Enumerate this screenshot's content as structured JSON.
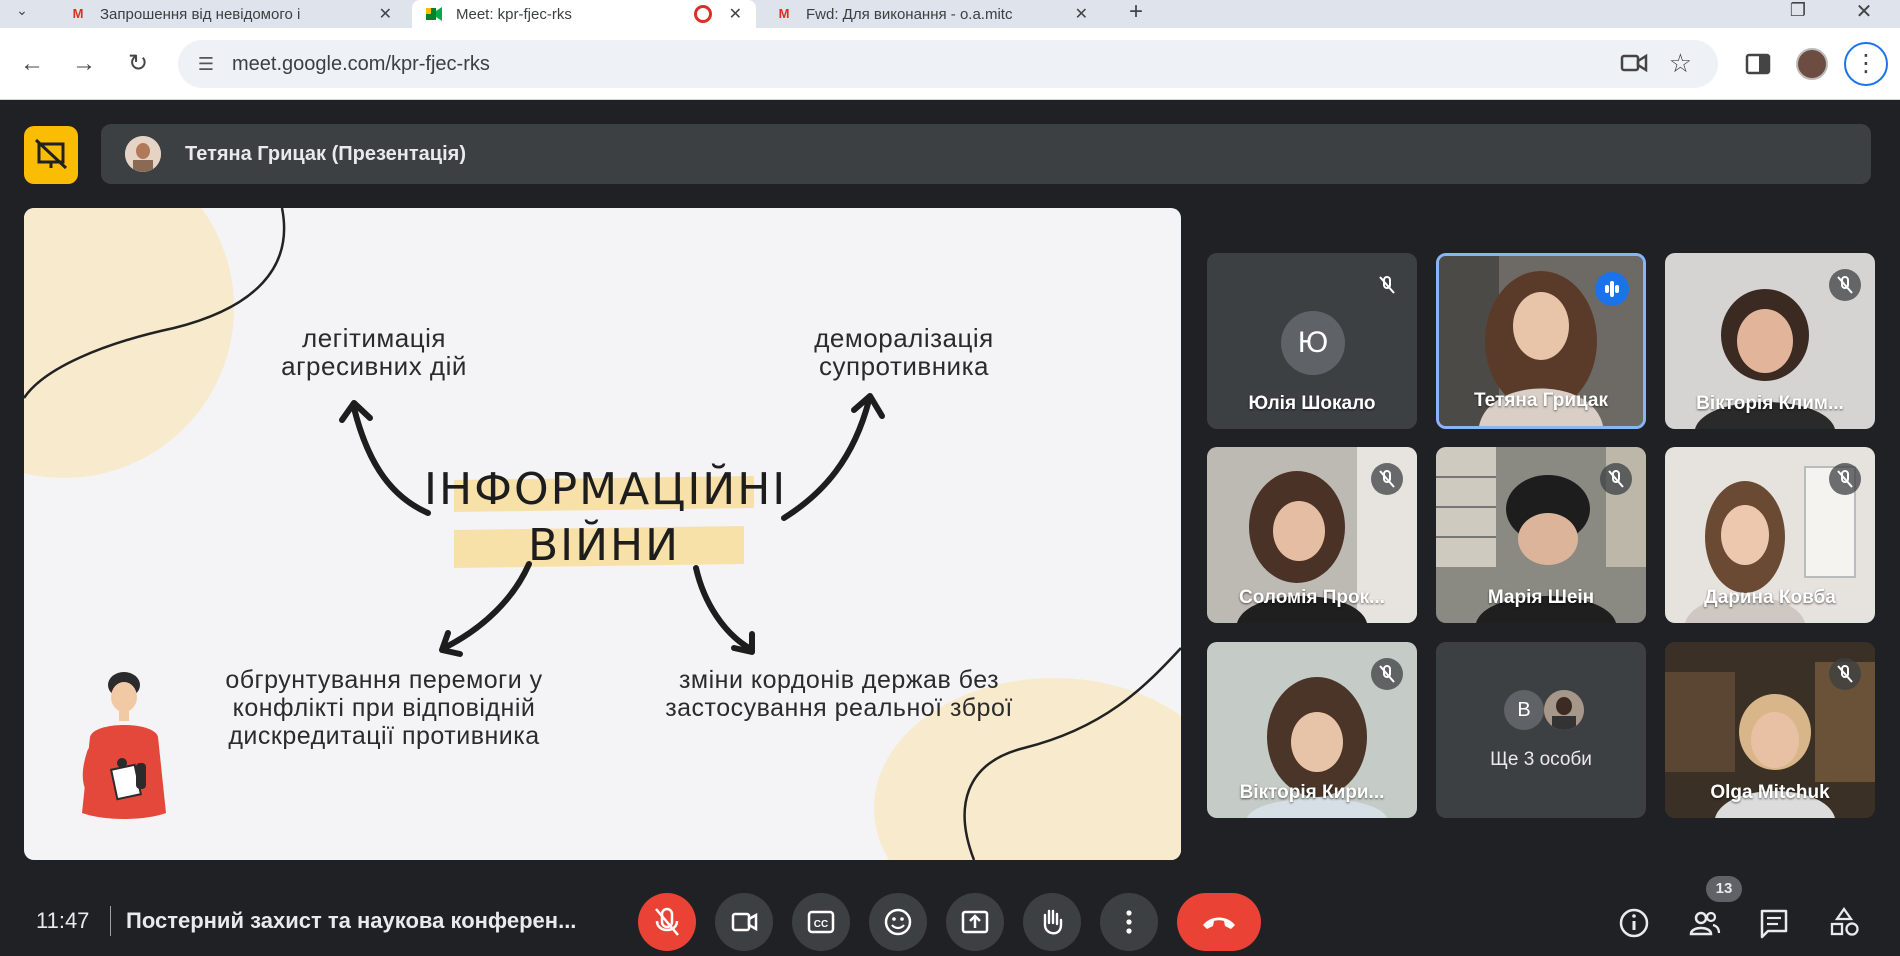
{
  "browser": {
    "tabs": [
      {
        "title": "Запрошення від невідомого і",
        "favicon": "gmail-icon"
      },
      {
        "title": "Meet: kpr-fjec-rks",
        "favicon": "meet-icon"
      },
      {
        "title": "Fwd: Для виконання - o.a.mitc",
        "favicon": "gmail-icon"
      }
    ],
    "url": "meet.google.com/kpr-fjec-rks"
  },
  "presenter": {
    "label": "Тетяна Грицак (Презентація)"
  },
  "slide": {
    "title_line1": "ІНФОРМАЦІЙНІ",
    "title_line2": "ВІЙНИ",
    "top_left": [
      "легітимація",
      "агресивних дій"
    ],
    "top_right": [
      "деморалізація",
      "супротивника"
    ],
    "bottom_left": [
      "обгрунтування перемоги у",
      "конфлікті при відповідній",
      "дискредитації противника"
    ],
    "bottom_right": [
      "зміни кордонів держав без",
      "застосування реальної зброї"
    ]
  },
  "participants": [
    {
      "name": "Юлія Шокало",
      "avatar_letter": "Ю",
      "muted": true
    },
    {
      "name": "Тетяна Грицак",
      "speaking": true
    },
    {
      "name": "Вікторія Клим...",
      "muted": true
    },
    {
      "name": "Соломія Прок...",
      "muted": true
    },
    {
      "name": "Марія Шеін",
      "muted": true
    },
    {
      "name": "Дарина Ковба",
      "muted": true
    },
    {
      "name": "Вікторія Кири...",
      "muted": true
    },
    {
      "name": "Ще 3 особи",
      "avatar_letter": "В"
    },
    {
      "name": "Olga Mitchuk",
      "muted": true
    }
  ],
  "bottom_bar": {
    "time": "11:47",
    "meeting_title": "Постерний захист та наукова конферен...",
    "participant_count": "13"
  },
  "colors": {
    "meet_bg": "#202124",
    "tile_bg": "#3c4043",
    "accent_yellow": "#fbbc04",
    "mic_off_red": "#ea4335",
    "speaking_blue": "#1a73e8"
  }
}
